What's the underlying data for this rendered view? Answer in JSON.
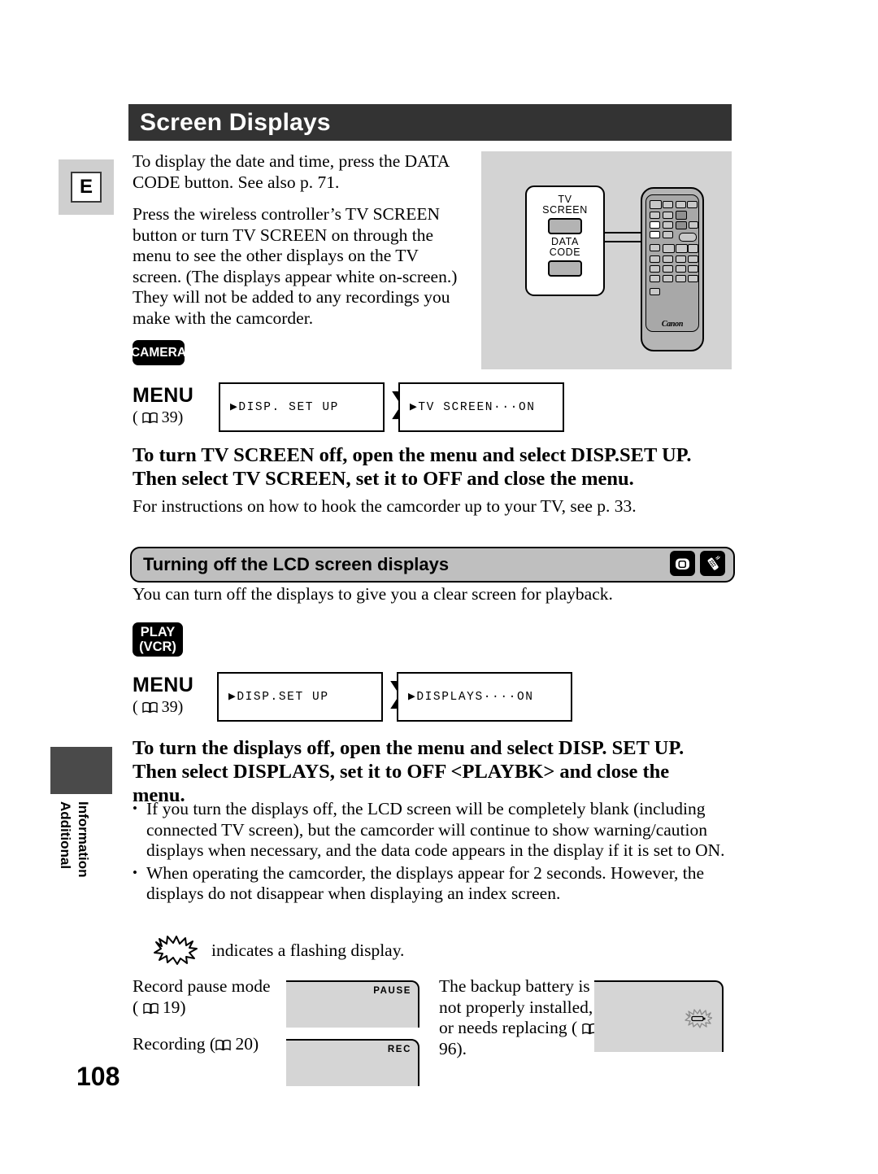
{
  "page": {
    "number": "108",
    "language_badge": "E",
    "sidebar_vertical": [
      "Additional",
      "Information"
    ]
  },
  "header": {
    "title": "Screen Displays"
  },
  "intro": {
    "paragraph_1": "To display the date and time, press the DATA CODE button. See also p. 71.",
    "paragraph_2": "Press the wireless controller’s TV SCREEN button or turn TV SCREEN on through the menu to see the other displays on the TV screen. (The displays appear white on-screen.) They will not be added to any recordings you make with the camcorder."
  },
  "remote_illustration": {
    "callout_label_1": "TV\nSCREEN",
    "callout_label_1_line1": "TV",
    "callout_label_1_line2": "SCREEN",
    "callout_label_2_line1": "DATA",
    "callout_label_2_line2": "CODE",
    "brand": "Canon"
  },
  "camera_section": {
    "mode_badge": "CAMERA",
    "menu_label": "MENU",
    "menu_pageref": "39",
    "menu_box_1": "▶DISP. SET UP",
    "menu_box_2": "▶TV SCREEN···ON",
    "instruction": "To turn TV SCREEN off, open the menu and select DISP.SET UP. Then select TV SCREEN, set it to OFF and close the menu.",
    "note": "For instructions on how to hook the camcorder up to your TV, see p. 33."
  },
  "lcd_section": {
    "section_title": "Turning off the LCD screen displays",
    "section_icons": [
      "camcorder-screen-icon",
      "wireless-controller-icon"
    ],
    "intro": "You can turn off the displays to give you a clear screen for playback.",
    "mode_badge_line1": "PLAY",
    "mode_badge_line2": "(VCR)",
    "menu_label": "MENU",
    "menu_pageref": "39",
    "menu_box_1": "▶DISP.SET UP",
    "menu_box_2": "▶DISPLAYS····ON",
    "instruction": "To turn the displays off, open the menu and select DISP. SET UP. Then select DISPLAYS, set it to OFF <PLAYBK> and close the menu.",
    "bullets": [
      "If you turn the displays off, the LCD screen will be completely blank (including connected TV screen), but the camcorder will continue to show warning/caution displays when necessary, and the data code appears in the display if it is set to ON.",
      "When operating the camcorder, the displays appear for 2 seconds. However, the displays do not disappear when displaying an index screen."
    ]
  },
  "flash_note": {
    "text": "indicates a flashing display.",
    "icon": "starburst-flash-icon"
  },
  "examples": {
    "left": [
      {
        "caption_line1": "Record pause mode",
        "caption_pageref": "19",
        "lcd_text": "PAUSE"
      },
      {
        "caption_line1": "Recording (",
        "caption_pageref": "20",
        "lcd_text": "REC"
      }
    ],
    "right": {
      "caption": "The backup battery is not properly installed, or needs replacing",
      "caption_pageref": "96",
      "lcd_icon": "flashing-battery-icon"
    }
  },
  "colors": {
    "title_bar": "#333333",
    "section_bar": "#bfbfbf",
    "lcd_fill": "#d5d5d5",
    "panel_fill": "#d3d3d3",
    "sidebar_tab": "#4a4a4a"
  }
}
